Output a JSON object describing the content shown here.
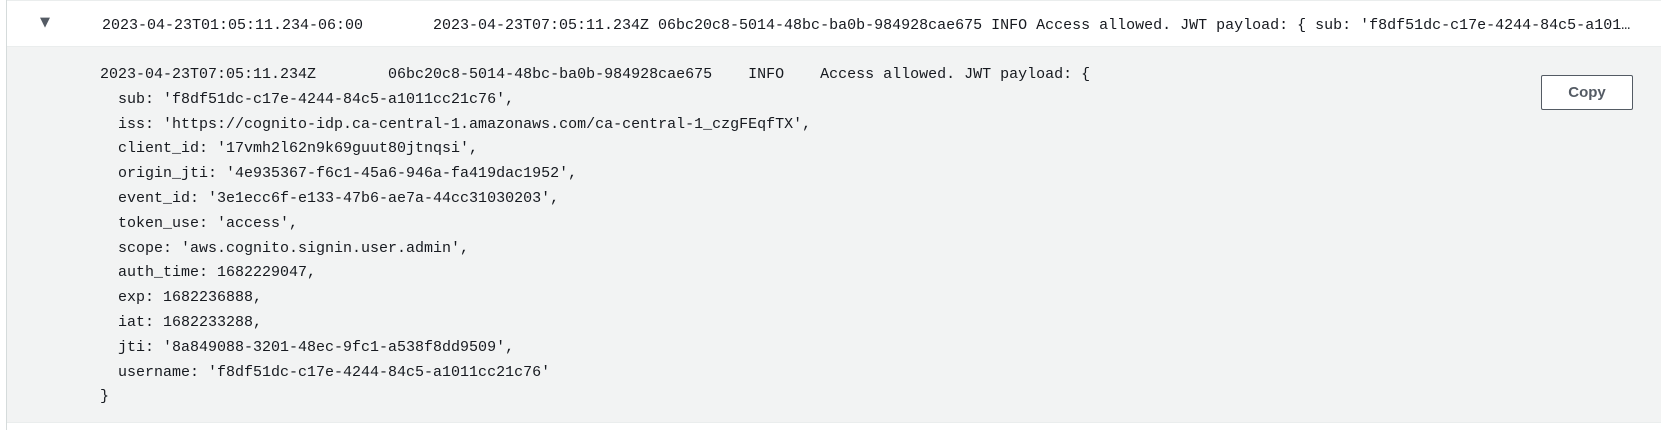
{
  "log_entry": {
    "timestamp": "2023-04-23T01:05:11.234-06:00",
    "message_preview": "2023-04-23T07:05:11.234Z 06bc20c8-5014-48bc-ba0b-984928cae675 INFO Access allowed. JWT payload: { sub: 'f8df51dc-c17e-4244-84c5-a1011cc21c76', iss: 'https://cognito-idp.ca-central-1.amazonaws.com/ca-central-1_czgFEqfTX', client_id: '17vmh2l62n9k69guut80jtnqsi', origin_jti: '4e935367-f6c1-45a6-946a-fa419dac1952', event_id: '3e1ecc6f-e133-47b6-ae7a-44cc31030203', token_use: 'access', scope: 'aws.cognito.signin.user.admin', auth_time: 1682229047, exp: 1682236888, iat: 1682233288, jti: '8a849088-3201-48ec-9fc1-a538f8dd9509', username: 'f8df51dc-c17e-4244-84c5-a1011cc21c76' }",
    "toggle_glyph": "▼",
    "detail": {
      "text": "2023-04-23T07:05:11.234Z\t06bc20c8-5014-48bc-ba0b-984928cae675\tINFO\tAccess allowed. JWT payload: {\n  sub: 'f8df51dc-c17e-4244-84c5-a1011cc21c76',\n  iss: 'https://cognito-idp.ca-central-1.amazonaws.com/ca-central-1_czgFEqfTX',\n  client_id: '17vmh2l62n9k69guut80jtnqsi',\n  origin_jti: '4e935367-f6c1-45a6-946a-fa419dac1952',\n  event_id: '3e1ecc6f-e133-47b6-ae7a-44cc31030203',\n  token_use: 'access',\n  scope: 'aws.cognito.signin.user.admin',\n  auth_time: 1682229047,\n  exp: 1682236888,\n  iat: 1682233288,\n  jti: '8a849088-3201-48ec-9fc1-a538f8dd9509',\n  username: 'f8df51dc-c17e-4244-84c5-a1011cc21c76'\n}",
      "copy_label": "Copy"
    }
  }
}
